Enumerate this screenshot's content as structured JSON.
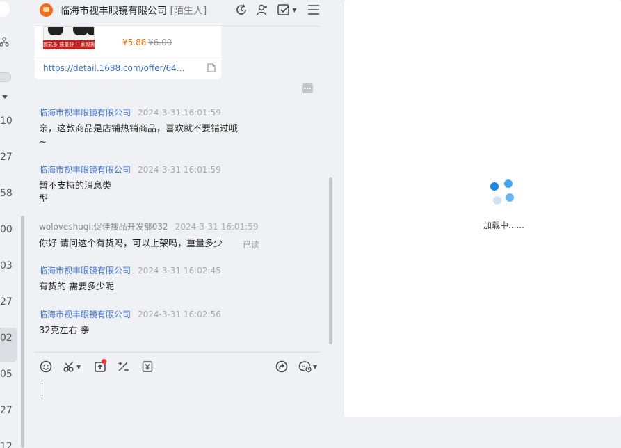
{
  "sidebar": {
    "numbers": [
      "10",
      "27",
      "58",
      "00",
      "03",
      "27",
      "02",
      "05",
      "27",
      "12"
    ]
  },
  "header": {
    "shop_name": "临海市视丰眼镜有限公司",
    "stranger_tag": "[陌生人]"
  },
  "product_card": {
    "image_band_text": "款式多 质量好 厂家现货",
    "price": "¥5.88",
    "original_price": "¥6.00",
    "link": "https://detail.1688.com/offer/64..."
  },
  "messages": [
    {
      "sender": "临海市视丰眼镜有限公司",
      "time": "2024-3-31 16:01:59",
      "text": "亲，这款商品是店铺热销商品，喜欢就不要错过哦\n~"
    },
    {
      "sender": "临海市视丰眼镜有限公司",
      "time": "2024-3-31 16:01:59",
      "text": "暂不支持的消息类\n型"
    },
    {
      "sender": "woloveshuqi:促佳搜品开发部032",
      "time": "2024-3-31 16:01:59",
      "text": "你好 请问这个有货吗，可以上架吗，重量多少",
      "status": "已读"
    },
    {
      "sender": "临海市视丰眼镜有限公司",
      "time": "2024-3-31 16:02:45",
      "text": "有货的  需要多少呢"
    },
    {
      "sender": "临海市视丰眼镜有限公司",
      "time": "2024-3-31 16:02:56",
      "text": "32克左右  亲"
    }
  ],
  "right_pane": {
    "loading_text": "加载中......"
  },
  "colors": {
    "accent_blue": "#3a74d8",
    "price_orange": "#ff6a00",
    "spinner_blue": "#2196f3"
  },
  "icons": [
    "refresh-icon",
    "add-user-icon",
    "task-check-icon",
    "menu-icon",
    "emoji-icon",
    "scissors-icon",
    "upload-icon",
    "quick-phrase-icon",
    "coupon-icon",
    "share-icon",
    "chat-history-icon",
    "doc-icon"
  ]
}
